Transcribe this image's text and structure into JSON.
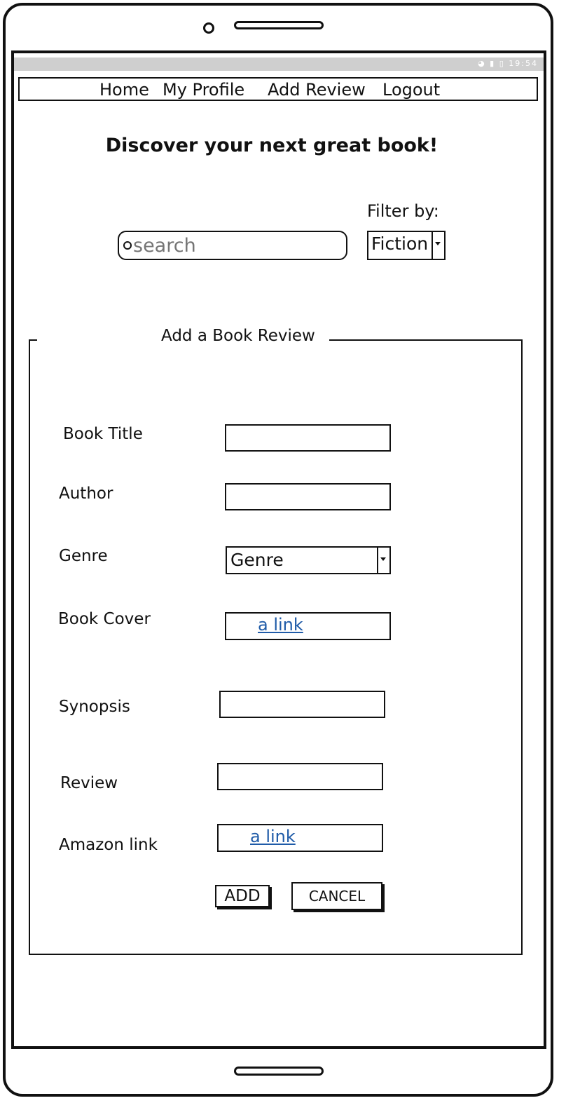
{
  "nav": {
    "items": [
      "Home",
      "My Profile",
      "Add Review",
      "Logout"
    ]
  },
  "status_bar": {
    "time": "19:54"
  },
  "headline": "Discover your next great book!",
  "search": {
    "placeholder": "search"
  },
  "filter": {
    "label": "Filter by:",
    "selected": "Fiction"
  },
  "form": {
    "title": "Add a Book Review",
    "labels": {
      "book_title": "Book Title",
      "author": "Author",
      "genre": "Genre",
      "book_cover": "Book Cover",
      "synopsis": "Synopsis",
      "review": "Review",
      "amazon_link": "Amazon link"
    },
    "genre_selected": "Genre",
    "book_cover_link": "a link",
    "amazon_link_text": "a link",
    "add_button": "ADD",
    "cancel_button": "CANCEL"
  },
  "icons": {
    "search": "search-icon",
    "dropdown": "chevron-down-icon",
    "wifi": "wifi-icon",
    "signal": "signal-icon",
    "battery": "battery-icon"
  }
}
